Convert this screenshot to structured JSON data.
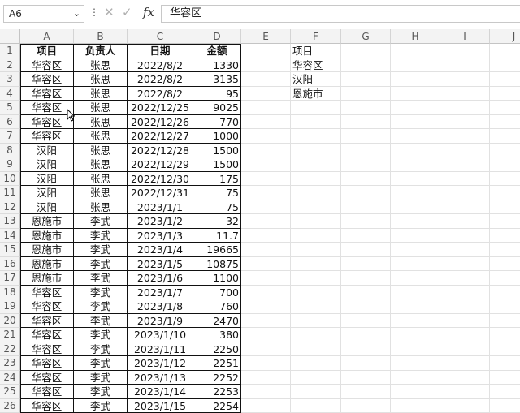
{
  "formula_bar": {
    "name_box": "A6",
    "fx_label": "fx",
    "formula": "华容区"
  },
  "columns": [
    "A",
    "B",
    "C",
    "D",
    "E",
    "F",
    "G",
    "H",
    "I",
    "J"
  ],
  "rows": [
    [
      "项目",
      "负责人",
      "日期",
      "金额"
    ],
    [
      "华容区",
      "张思",
      "2022/8/2",
      "1330"
    ],
    [
      "华容区",
      "张思",
      "2022/8/2",
      "3135"
    ],
    [
      "华容区",
      "张思",
      "2022/8/2",
      "95"
    ],
    [
      "华容区",
      "张思",
      "2022/12/25",
      "9025"
    ],
    [
      "华容区",
      "张思",
      "2022/12/26",
      "770"
    ],
    [
      "华容区",
      "张思",
      "2022/12/27",
      "1000"
    ],
    [
      "汉阳",
      "张思",
      "2022/12/28",
      "1500"
    ],
    [
      "汉阳",
      "张思",
      "2022/12/29",
      "1500"
    ],
    [
      "汉阳",
      "张思",
      "2022/12/30",
      "175"
    ],
    [
      "汉阳",
      "张思",
      "2022/12/31",
      "75"
    ],
    [
      "汉阳",
      "张思",
      "2023/1/1",
      "75"
    ],
    [
      "恩施市",
      "李武",
      "2023/1/2",
      "32"
    ],
    [
      "恩施市",
      "李武",
      "2023/1/3",
      "11.7"
    ],
    [
      "恩施市",
      "李武",
      "2023/1/4",
      "19665"
    ],
    [
      "恩施市",
      "李武",
      "2023/1/5",
      "10875"
    ],
    [
      "恩施市",
      "李武",
      "2023/1/6",
      "1100"
    ],
    [
      "华容区",
      "李武",
      "2023/1/7",
      "700"
    ],
    [
      "华容区",
      "李武",
      "2023/1/8",
      "760"
    ],
    [
      "华容区",
      "李武",
      "2023/1/9",
      "2470"
    ],
    [
      "华容区",
      "李武",
      "2023/1/10",
      "380"
    ],
    [
      "华容区",
      "李武",
      "2023/1/11",
      "2250"
    ],
    [
      "华容区",
      "李武",
      "2023/1/12",
      "2251"
    ],
    [
      "华容区",
      "李武",
      "2023/1/13",
      "2252"
    ],
    [
      "华容区",
      "李武",
      "2023/1/14",
      "2253"
    ],
    [
      "华容区",
      "李武",
      "2023/1/15",
      "2254"
    ]
  ],
  "side_list": [
    "项目",
    "华容区",
    "汉阳",
    "恩施市"
  ],
  "selected_cell": "A6"
}
